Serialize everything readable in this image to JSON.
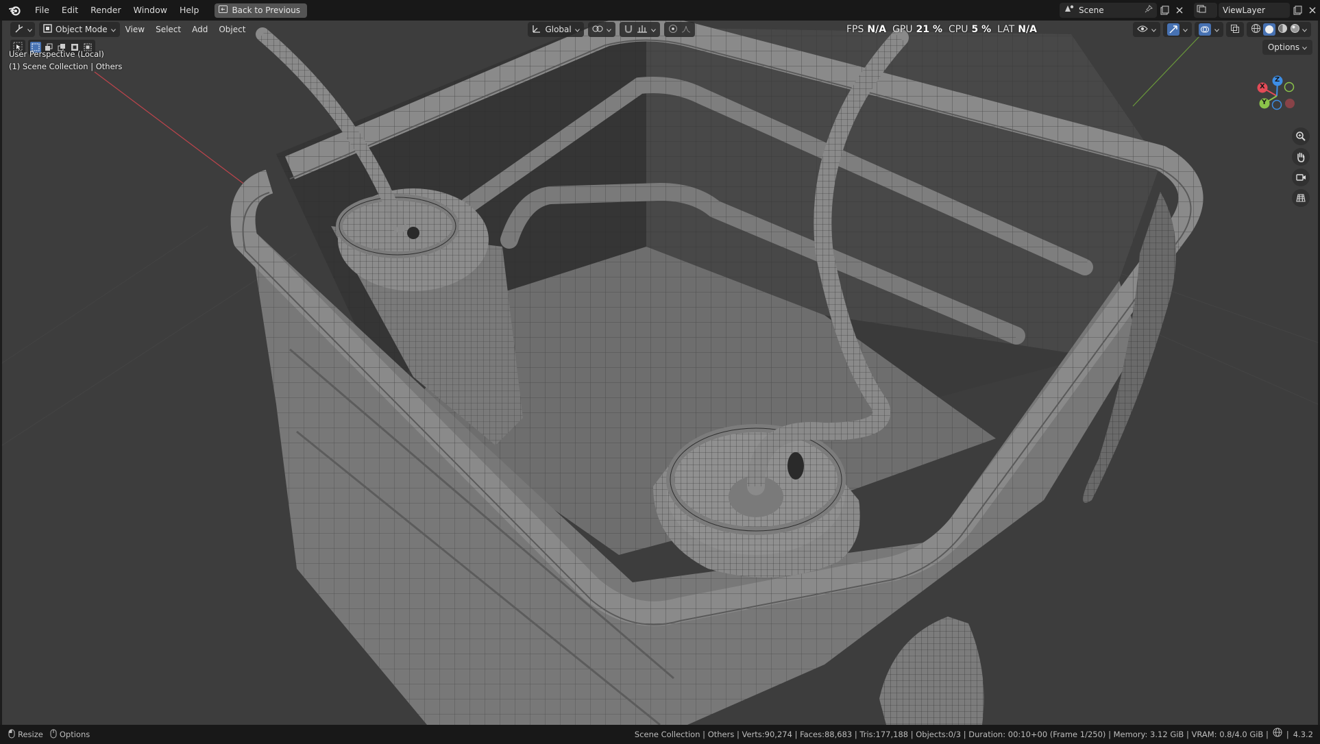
{
  "topbar": {
    "menus": [
      "File",
      "Edit",
      "Render",
      "Window",
      "Help"
    ],
    "back_label": "Back to Previous",
    "scene_value": "Scene",
    "viewlayer_value": "ViewLayer"
  },
  "viewport_header": {
    "mode_label": "Object Mode",
    "menus": [
      "View",
      "Select",
      "Add",
      "Object"
    ],
    "orientation_label": "Global",
    "options_label": "Options"
  },
  "perf": {
    "fps_label": "FPS",
    "fps_value": "N/A",
    "gpu_label": "GPU",
    "gpu_value": "21 %",
    "cpu_label": "CPU",
    "cpu_value": "5 %",
    "lat_label": "LAT",
    "lat_value": "N/A"
  },
  "viewport_info": {
    "line1": "User Perspective (Local)",
    "line2": "(1) Scene Collection | Others"
  },
  "gizmo": {
    "x_label": "X",
    "y_label": "Y",
    "z_label": "Z",
    "x_color": "#e34b57",
    "y_color": "#8bc44a",
    "z_color": "#3d8ee6"
  },
  "statusbar": {
    "resize_label": "Resize",
    "options_label": "Options",
    "info": "Scene Collection | Others | Verts:90,274 | Faces:88,683 | Tris:177,188 | Objects:0/3 | Duration: 00:10+00 (Frame 1/250) | Memory: 3.12 GiB | VRAM: 0.8/4.0 GiB |",
    "version": "4.3.2"
  },
  "colors": {
    "accent": "#4772b3",
    "ui_dark": "#181818",
    "viewport_bg": "#3d3d3d"
  }
}
